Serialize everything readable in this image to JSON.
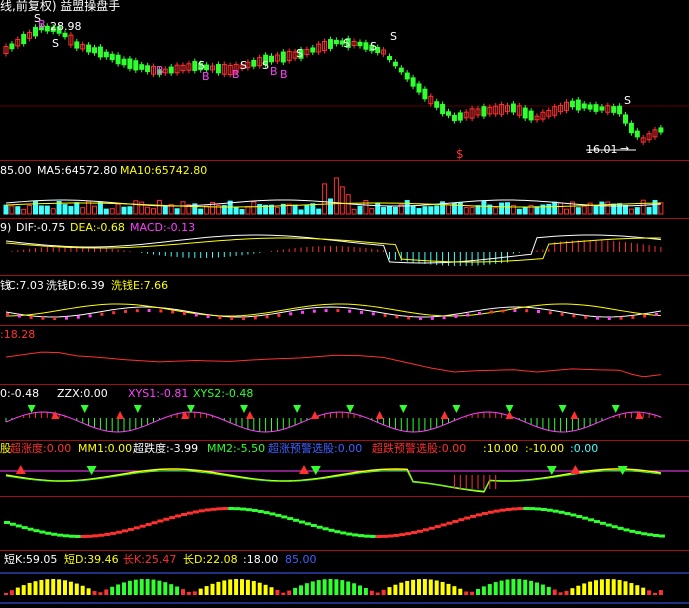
{
  "title_bar": {
    "text": "线,前复权) 益盟操盘手"
  },
  "main_chart": {
    "high_marker": "28.98",
    "low_marker": "16.01",
    "low_arrow": "→",
    "buy_marker": "B",
    "sell_marker": "S",
    "dollar_marker": "$"
  },
  "volume_panel": {
    "vol_value": "85.00",
    "ma5": "MA5:64572.80",
    "ma10": "MA10:65742.80"
  },
  "macd_panel": {
    "prefix": "9)",
    "dif": "DIF:-0.75",
    "dea": "DEA:-0.68",
    "macd": "MACD:-0.13"
  },
  "wash_panel": {
    "c": "C:7.03",
    "d": "洗钱D:6.39",
    "e": "洗钱E:7.66",
    "prefix": "钱"
  },
  "line_panel": {
    "value": ":18.28"
  },
  "xys_panel": {
    "v0": "0:-0.48",
    "zzx": "ZZX:0.00",
    "xys1": "XYS1:-0.81",
    "xys2": "XYS2:-0.48"
  },
  "super_panel": {
    "prefix": "股",
    "rise": "超涨度:0.00",
    "mm1": "MM1:0.00",
    "fall": "超跌度:-3.99",
    "mm2": "MM2:-5.50",
    "rise_warn": "超涨预警选股:0.00",
    "fall_warn": "超跌预警选股:0.00",
    "v1": ":10.00",
    "v2": ":-10.00",
    "v3": ":0.00"
  },
  "kd_panel": {
    "short_k": "短K:59.05",
    "short_d": "短D:39.46",
    "long_k": "长K:25.47",
    "long_d": "长D:22.08",
    "v1": ":18.00",
    "v2": "85.00"
  },
  "colors": {
    "up": "#ff3030",
    "down": "#30ff30",
    "grid": "#a01010",
    "cyan": "#40ffff",
    "yellow": "#ffff00"
  }
}
